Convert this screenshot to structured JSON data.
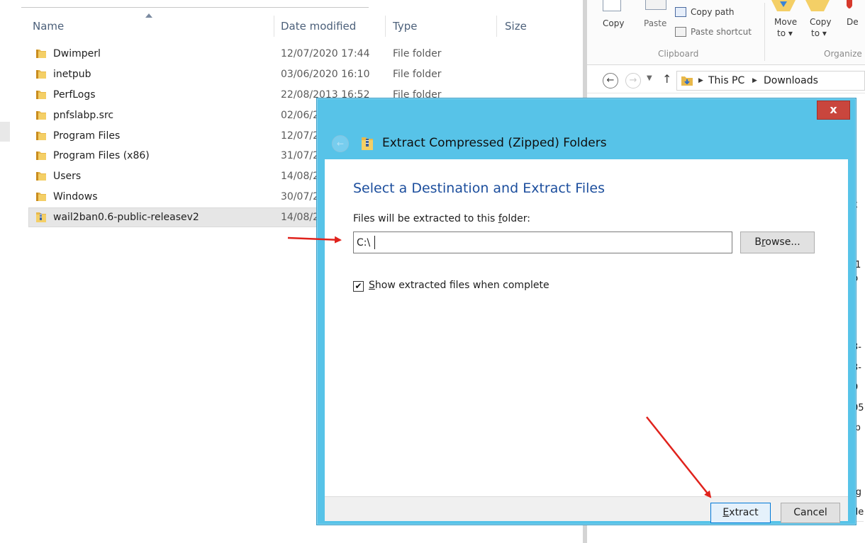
{
  "file_list": {
    "columns": {
      "name": "Name",
      "date": "Date modified",
      "type": "Type",
      "size": "Size"
    },
    "rows": [
      {
        "name": "Dwimperl",
        "date": "12/07/2020 17:44",
        "type": "File folder"
      },
      {
        "name": "inetpub",
        "date": "03/06/2020 16:10",
        "type": "File folder"
      },
      {
        "name": "PerfLogs",
        "date": "22/08/2013 16:52",
        "type": "File folder"
      },
      {
        "name": "pnfslabp.src",
        "date": "02/06/2"
      },
      {
        "name": "Program Files",
        "date": "12/07/2"
      },
      {
        "name": "Program Files (x86)",
        "date": "31/07/2"
      },
      {
        "name": "Users",
        "date": "14/08/2"
      },
      {
        "name": "Windows",
        "date": "30/07/2"
      },
      {
        "name": "wail2ban0.6-public-releasev2",
        "date": "14/08/2"
      }
    ]
  },
  "ribbon": {
    "copy": "Copy",
    "paste": "Paste",
    "copy_path": "Copy path",
    "paste_shortcut": "Paste shortcut",
    "move_to": "Move",
    "move_to_2": "to",
    "copy_to": "Copy",
    "copy_to_2": "to",
    "delete_partial": "De",
    "group_clipboard": "Clipboard",
    "group_organize": "Organize"
  },
  "address_bar": {
    "segments": [
      "This PC",
      "Downloads"
    ]
  },
  "right_side_fragments": [
    "k",
    ".1",
    "b",
    "3-",
    "3-",
    "9",
    "05",
    "ip",
    "-g",
    "de",
    "ub"
  ],
  "dialog": {
    "title": "Extract Compressed (Zipped) Folders",
    "close_glyph": "x",
    "heading": "Select a Destination and Extract Files",
    "folder_label_pre": "Files will be extracted to this ",
    "folder_label_key": "f",
    "folder_label_post": "older:",
    "destination_value": "C:\\",
    "browse_key": "r",
    "browse_pre": "B",
    "browse_post": "owse...",
    "checkbox_checked": true,
    "checkbox_key": "S",
    "checkbox_post": "how extracted files when complete",
    "extract_key": "E",
    "extract_post": "xtract",
    "cancel": "Cancel"
  },
  "colors": {
    "dialog_frame": "#57c3e8",
    "close_button": "#c9463d",
    "heading": "#1c4e9d",
    "arrow": "#e0221c"
  }
}
